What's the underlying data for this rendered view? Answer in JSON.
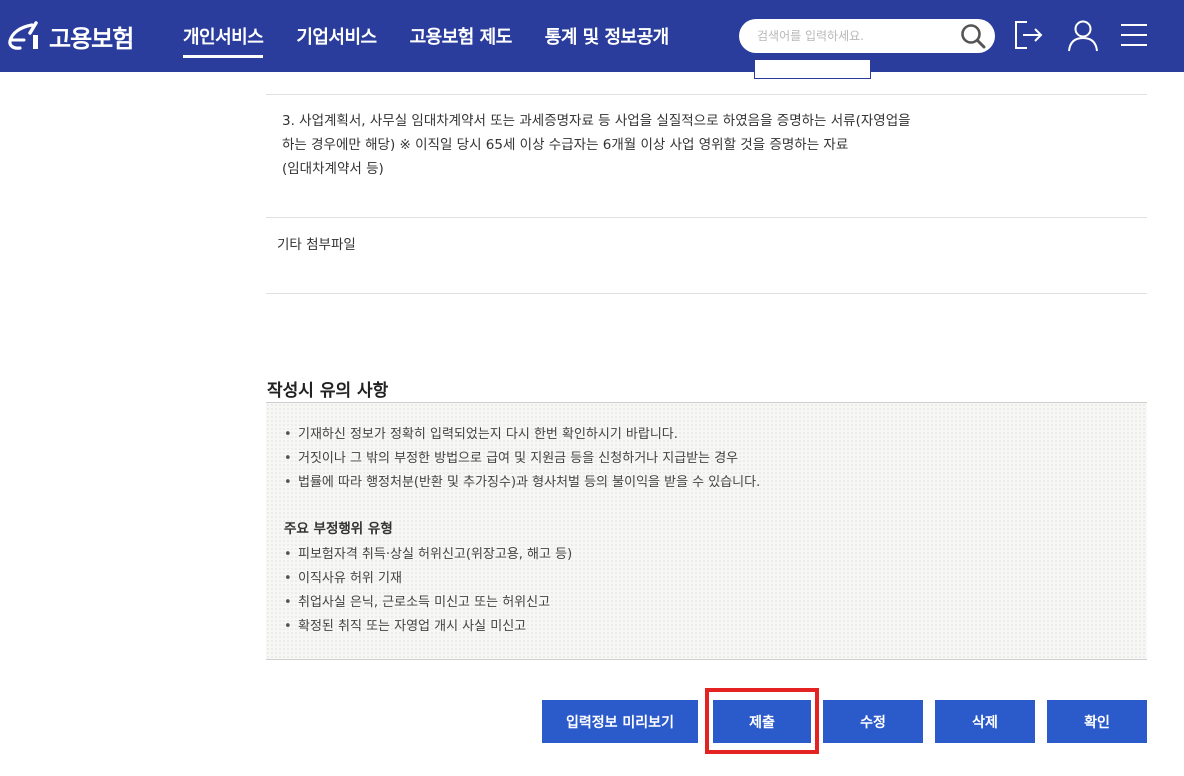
{
  "header": {
    "logo_text": "고용보험",
    "nav": [
      {
        "label": "개인서비스",
        "active": true
      },
      {
        "label": "기업서비스",
        "active": false
      },
      {
        "label": "고용보험 제도",
        "active": false
      },
      {
        "label": "통계 및 정보공개",
        "active": false
      }
    ],
    "search_placeholder": "검색어를 입력하세요.",
    "icons": [
      "search-icon",
      "logout-icon",
      "user-icon",
      "menu-icon"
    ],
    "bg_color": "#2a3d9c"
  },
  "documents": {
    "item3_lines": [
      "3. 사업계획서, 사무실 임대차계약서 또는 과세증명자료 등 사업을 실질적으로 하였음을 증명하는 서류(자영업을",
      "하는 경우에만 해당) ※ 이직일 당시 65세 이상 수급자는 6개월 이상 사업 영위할 것을 증명하는 자료",
      "(임대차계약서 등)"
    ],
    "etc_label": "기타 첨부파일"
  },
  "notice": {
    "title": "작성시 유의 사항",
    "items": [
      "기재하신 정보가 정확히 입력되었는지 다시 한번 확인하시기 바랍니다.",
      "거짓이나 그 밖의 부정한 방법으로 급여 및 지원금 등을 신청하거나 지급받는 경우",
      "법률에 따라 행정처분(반환 및 추가징수)과 형사처벌 등의 불이익을 받을 수 있습니다."
    ],
    "fraud_title": "주요 부정행위 유형",
    "fraud_items": [
      "피보험자격 취득·상실 허위신고(위장고용, 해고 등)",
      "이직사유 허위 기재",
      "취업사실 은닉, 근로소득 미신고 또는 허위신고",
      "확정된 취직 또는 자영업 개시 사실 미신고"
    ]
  },
  "buttons": {
    "preview": "입력정보 미리보기",
    "submit": "제출",
    "edit": "수정",
    "delete": "삭제",
    "confirm": "확인"
  },
  "colors": {
    "button": "#2b5acb",
    "highlight": "#e52222"
  }
}
